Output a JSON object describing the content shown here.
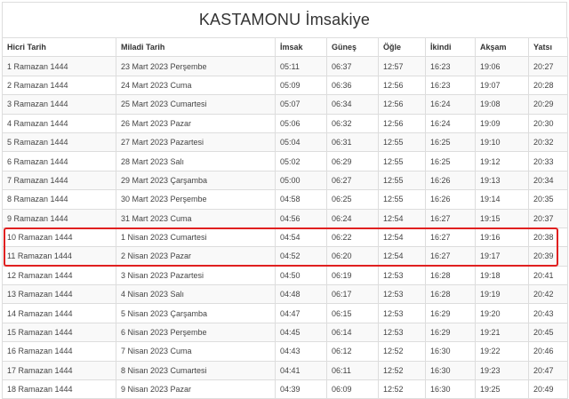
{
  "title": "KASTAMONU İmsakiye",
  "highlight_color": "#e02020",
  "columns": [
    "Hicri Tarih",
    "Miladi Tarih",
    "İmsak",
    "Güneş",
    "Öğle",
    "İkindi",
    "Akşam",
    "Yatsı"
  ],
  "rows": [
    [
      "1 Ramazan 1444",
      "23 Mart 2023 Perşembe",
      "05:11",
      "06:37",
      "12:57",
      "16:23",
      "19:06",
      "20:27"
    ],
    [
      "2 Ramazan 1444",
      "24 Mart 2023 Cuma",
      "05:09",
      "06:36",
      "12:56",
      "16:23",
      "19:07",
      "20:28"
    ],
    [
      "3 Ramazan 1444",
      "25 Mart 2023 Cumartesi",
      "05:07",
      "06:34",
      "12:56",
      "16:24",
      "19:08",
      "20:29"
    ],
    [
      "4 Ramazan 1444",
      "26 Mart 2023 Pazar",
      "05:06",
      "06:32",
      "12:56",
      "16:24",
      "19:09",
      "20:30"
    ],
    [
      "5 Ramazan 1444",
      "27 Mart 2023 Pazartesi",
      "05:04",
      "06:31",
      "12:55",
      "16:25",
      "19:10",
      "20:32"
    ],
    [
      "6 Ramazan 1444",
      "28 Mart 2023 Salı",
      "05:02",
      "06:29",
      "12:55",
      "16:25",
      "19:12",
      "20:33"
    ],
    [
      "7 Ramazan 1444",
      "29 Mart 2023 Çarşamba",
      "05:00",
      "06:27",
      "12:55",
      "16:26",
      "19:13",
      "20:34"
    ],
    [
      "8 Ramazan 1444",
      "30 Mart 2023 Perşembe",
      "04:58",
      "06:25",
      "12:55",
      "16:26",
      "19:14",
      "20:35"
    ],
    [
      "9 Ramazan 1444",
      "31 Mart 2023 Cuma",
      "04:56",
      "06:24",
      "12:54",
      "16:27",
      "19:15",
      "20:37"
    ],
    [
      "10 Ramazan 1444",
      "1 Nisan 2023 Cumartesi",
      "04:54",
      "06:22",
      "12:54",
      "16:27",
      "19:16",
      "20:38"
    ],
    [
      "11 Ramazan 1444",
      "2 Nisan 2023 Pazar",
      "04:52",
      "06:20",
      "12:54",
      "16:27",
      "19:17",
      "20:39"
    ],
    [
      "12 Ramazan 1444",
      "3 Nisan 2023 Pazartesi",
      "04:50",
      "06:19",
      "12:53",
      "16:28",
      "19:18",
      "20:41"
    ],
    [
      "13 Ramazan 1444",
      "4 Nisan 2023 Salı",
      "04:48",
      "06:17",
      "12:53",
      "16:28",
      "19:19",
      "20:42"
    ],
    [
      "14 Ramazan 1444",
      "5 Nisan 2023 Çarşamba",
      "04:47",
      "06:15",
      "12:53",
      "16:29",
      "19:20",
      "20:43"
    ],
    [
      "15 Ramazan 1444",
      "6 Nisan 2023 Perşembe",
      "04:45",
      "06:14",
      "12:53",
      "16:29",
      "19:21",
      "20:45"
    ],
    [
      "16 Ramazan 1444",
      "7 Nisan 2023 Cuma",
      "04:43",
      "06:12",
      "12:52",
      "16:30",
      "19:22",
      "20:46"
    ],
    [
      "17 Ramazan 1444",
      "8 Nisan 2023 Cumartesi",
      "04:41",
      "06:11",
      "12:52",
      "16:30",
      "19:23",
      "20:47"
    ],
    [
      "18 Ramazan 1444",
      "9 Nisan 2023 Pazar",
      "04:39",
      "06:09",
      "12:52",
      "16:30",
      "19:25",
      "20:49"
    ]
  ]
}
